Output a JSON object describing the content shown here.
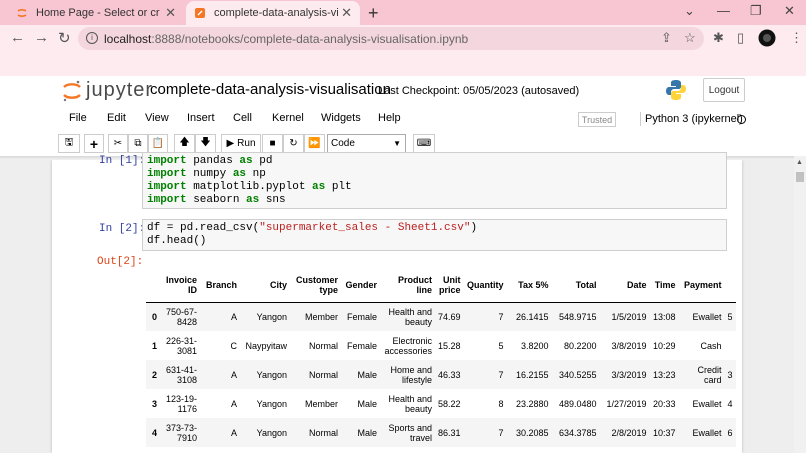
{
  "browser": {
    "tabs": [
      {
        "title": "Home Page - Select or create a n",
        "close": "✕"
      },
      {
        "title": "complete-data-analysis-visualisat",
        "close": "✕"
      }
    ],
    "new_tab": "+",
    "url_host": "localhost",
    "url_path": ":8888/notebooks/complete-data-analysis-visualisation.ipynb",
    "win_min": "⌄",
    "win_dash": "—",
    "win_restore": "❐",
    "win_close": "✕"
  },
  "jupyter": {
    "logo_text": "jupyter",
    "notebook_name": "complete-data-analysis-visualisation",
    "checkpoint": "Last Checkpoint: 05/05/2023  (autosaved)",
    "logout": "Logout",
    "menu": [
      "File",
      "Edit",
      "View",
      "Insert",
      "Cell",
      "Kernel",
      "Widgets",
      "Help"
    ],
    "trusted": "Trusted",
    "kernel": "Python 3 (ipykernel)",
    "run_label": "Run",
    "cell_type": "Code"
  },
  "cells": {
    "in1_prompt": "In [1]:",
    "in1_lines": [
      {
        "kw": "import",
        "a": " pandas ",
        "kw2": "as",
        "b": " pd"
      },
      {
        "kw": "import",
        "a": " numpy ",
        "kw2": "as",
        "b": " np"
      },
      {
        "kw": "import",
        "a": " matplotlib.pyplot ",
        "kw2": "as",
        "b": " plt"
      },
      {
        "kw": "import",
        "a": " seaborn ",
        "kw2": "as",
        "b": " sns"
      }
    ],
    "in2_prompt": "In [2]:",
    "in2_line1_a": "df = pd.read_csv(",
    "in2_line1_str": "\"supermarket_sales - Sheet1.csv\"",
    "in2_line1_b": ")",
    "in2_line2": "df.head()",
    "out2_prompt": "Out[2]:"
  },
  "table": {
    "headers": [
      "",
      "Invoice ID",
      "Branch",
      "City",
      "Customer type",
      "Gender",
      "Product line",
      "Unit price",
      "Quantity",
      "Tax 5%",
      "Total",
      "Date",
      "Time",
      "Payment",
      ""
    ],
    "rows": [
      [
        "0",
        "750-67-8428",
        "A",
        "Yangon",
        "Member",
        "Female",
        "Health and beauty",
        "74.69",
        "7",
        "26.1415",
        "548.9715",
        "1/5/2019",
        "13:08",
        "Ewallet",
        "5"
      ],
      [
        "1",
        "226-31-3081",
        "C",
        "Naypyitaw",
        "Normal",
        "Female",
        "Electronic accessories",
        "15.28",
        "5",
        "3.8200",
        "80.2200",
        "3/8/2019",
        "10:29",
        "Cash",
        ""
      ],
      [
        "2",
        "631-41-3108",
        "A",
        "Yangon",
        "Normal",
        "Male",
        "Home and lifestyle",
        "46.33",
        "7",
        "16.2155",
        "340.5255",
        "3/3/2019",
        "13:23",
        "Credit card",
        "3"
      ],
      [
        "3",
        "123-19-1176",
        "A",
        "Yangon",
        "Member",
        "Male",
        "Health and beauty",
        "58.22",
        "8",
        "23.2880",
        "489.0480",
        "1/27/2019",
        "20:33",
        "Ewallet",
        "4"
      ],
      [
        "4",
        "373-73-7910",
        "A",
        "Yangon",
        "Normal",
        "Male",
        "Sports and travel",
        "86.31",
        "7",
        "30.2085",
        "634.3785",
        "2/8/2019",
        "10:37",
        "Ewallet",
        "6"
      ]
    ]
  },
  "colors": {
    "tabstrip": "#f7c6d2",
    "active_tab": "#fdebf0",
    "prompt_in": "#303F9F",
    "prompt_out": "#D84315",
    "jupyter_orange": "#F37726"
  }
}
